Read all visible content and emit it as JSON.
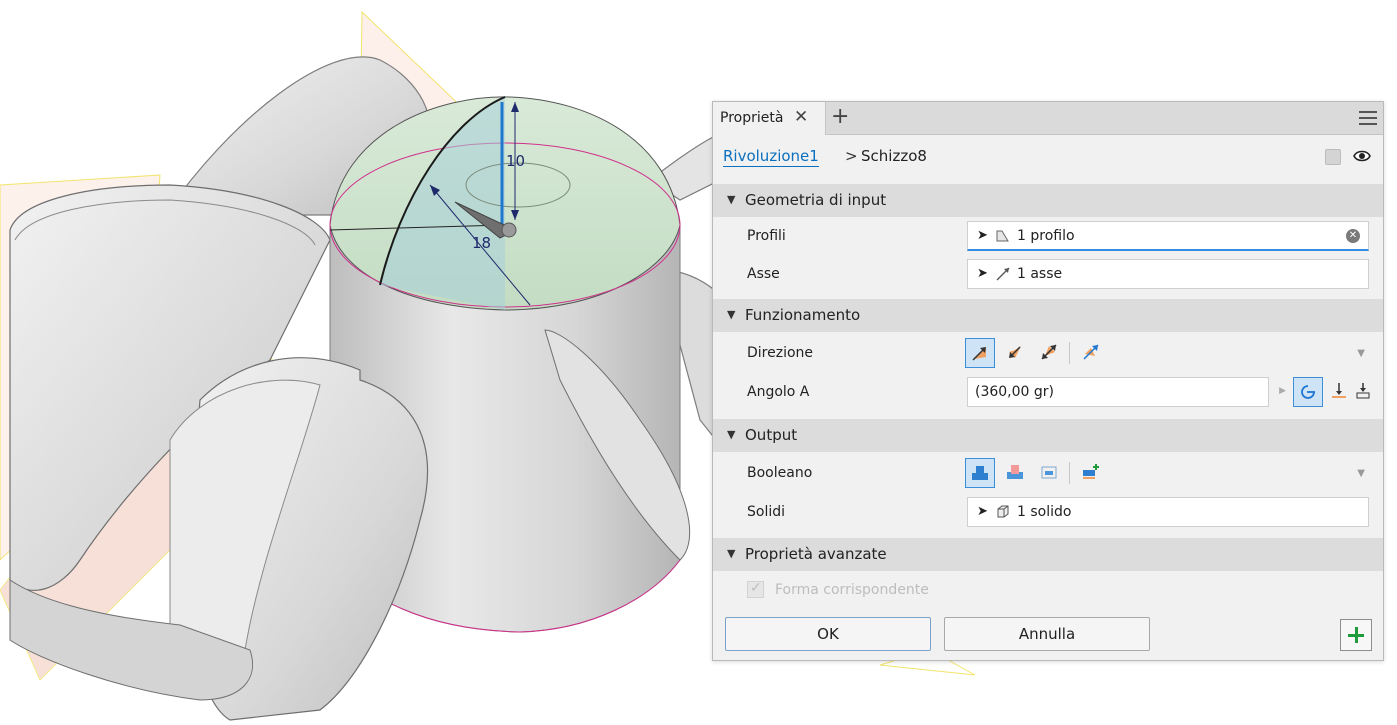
{
  "viewport": {
    "dimension_vertical": "10",
    "dimension_diameter": "18"
  },
  "panel": {
    "tab_label": "Proprietà",
    "breadcrumb": {
      "parent": "Rivoluzione1",
      "separator": ">",
      "child": "Schizzo8"
    },
    "sections": {
      "input_geometry": {
        "title": "Geometria di input",
        "profiles_label": "Profili",
        "profiles_value": "1 profilo",
        "axis_label": "Asse",
        "axis_value": "1 asse"
      },
      "behavior": {
        "title": "Funzionamento",
        "direction_label": "Direzione",
        "angle_label": "Angolo A",
        "angle_value": "(360,00 gr)"
      },
      "output": {
        "title": "Output",
        "boolean_label": "Booleano",
        "solids_label": "Solidi",
        "solids_value": "1 solido"
      },
      "advanced": {
        "title": "Proprietà avanzate",
        "match_shape_label": "Forma corrispondente",
        "match_shape_checked": true
      }
    },
    "buttons": {
      "ok": "OK",
      "cancel": "Annulla"
    },
    "colors": {
      "accent_blue": "#2f8de4",
      "link_blue": "#0a6fbf",
      "apply_green": "#1f9b3c",
      "preview_orange": "#f0a060"
    }
  }
}
